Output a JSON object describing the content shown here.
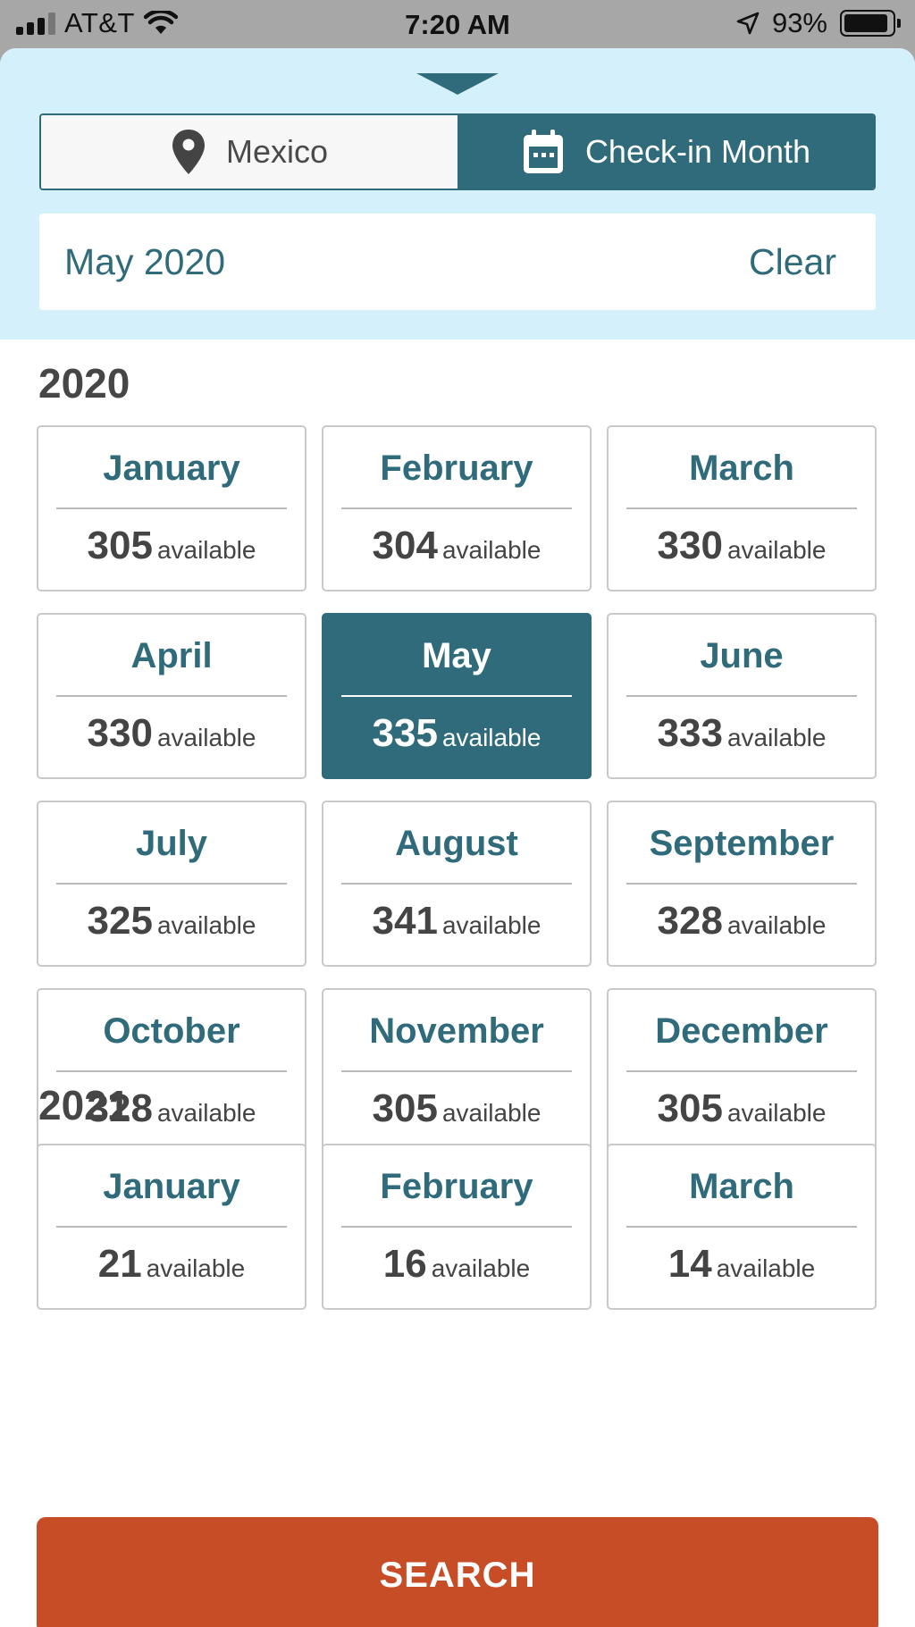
{
  "status_bar": {
    "carrier": "AT&T",
    "time": "7:20 AM",
    "battery": "93%"
  },
  "segments": {
    "location_label": "Mexico",
    "month_label": "Check-in Month"
  },
  "selection": {
    "value": "May 2020",
    "clear_label": "Clear"
  },
  "years": [
    {
      "year": "2020",
      "months": [
        {
          "name": "January",
          "count": "305"
        },
        {
          "name": "February",
          "count": "304"
        },
        {
          "name": "March",
          "count": "330"
        },
        {
          "name": "April",
          "count": "330"
        },
        {
          "name": "May",
          "count": "335",
          "selected": true
        },
        {
          "name": "June",
          "count": "333"
        },
        {
          "name": "July",
          "count": "325"
        },
        {
          "name": "August",
          "count": "341"
        },
        {
          "name": "September",
          "count": "328"
        },
        {
          "name": "October",
          "count": "328"
        },
        {
          "name": "November",
          "count": "305"
        },
        {
          "name": "December",
          "count": "305"
        }
      ]
    },
    {
      "year": "2021",
      "months": [
        {
          "name": "January",
          "count": "21"
        },
        {
          "name": "February",
          "count": "16"
        },
        {
          "name": "March",
          "count": "14"
        }
      ]
    }
  ],
  "available_label": "available",
  "search_label": "SEARCH",
  "colors": {
    "accent": "#2f6b7a",
    "header_bg": "#d3f0fb",
    "search_button": "#c64d26"
  },
  "icons": {
    "location": "map-pin-icon",
    "calendar": "calendar-icon",
    "grabber": "chevron-down-icon"
  }
}
